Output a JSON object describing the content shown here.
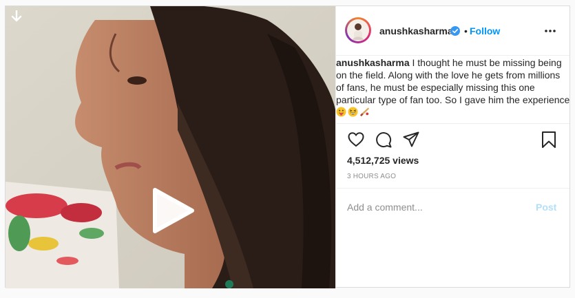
{
  "header": {
    "username": "anushkasharma",
    "separator": "•",
    "follow_label": "Follow",
    "verified_icon": "verified-badge-icon",
    "more_icon": "more-options-icon"
  },
  "caption": {
    "username": "anushkasharma",
    "text": "I thought he must be missing being on the field. Along with the love he gets from millions of fans, he must be especially missing this one particular type of fan too. So I gave him the experience",
    "emojis": [
      "face-with-tongue",
      "grinning-squinting-face",
      "cricket-bat"
    ]
  },
  "actions": {
    "icons": [
      "heart-icon",
      "comment-icon",
      "share-icon",
      "bookmark-icon"
    ]
  },
  "stats": {
    "views": "4,512,725 views",
    "time_ago": "3 HOURS AGO"
  },
  "comment": {
    "placeholder": "Add a comment...",
    "post_label": "Post"
  },
  "media": {
    "download_icon": "download-arrow-icon",
    "play_icon": "play-icon"
  },
  "colors": {
    "link_blue": "#0095f6",
    "post_disabled": "#b2dffc",
    "muted": "#8e8e8e"
  }
}
